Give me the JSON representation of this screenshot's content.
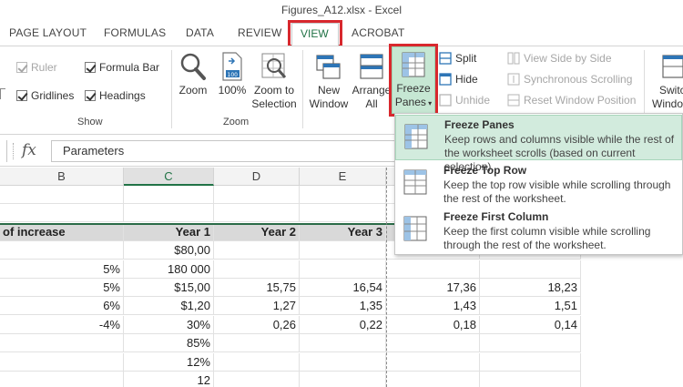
{
  "window": {
    "title": "Figures_A12.xlsx - Excel"
  },
  "tabs": [
    "PAGE LAYOUT",
    "FORMULAS",
    "DATA",
    "REVIEW",
    "VIEW",
    "ACROBAT"
  ],
  "ribbon": {
    "show_group": {
      "label": "Show",
      "ruler": "Ruler",
      "formula_bar": "Formula Bar",
      "gridlines": "Gridlines",
      "headings": "Headings"
    },
    "zoom_group": {
      "label": "Zoom",
      "zoom": "Zoom",
      "zoom100": "100%",
      "zoom_to_sel_1": "Zoom to",
      "zoom_to_sel_2": "Selection"
    },
    "window_group": {
      "new_window_1": "New",
      "new_window_2": "Window",
      "arrange_all_1": "Arrange",
      "arrange_all_2": "All",
      "freeze_1": "Freeze",
      "freeze_2": "Panes",
      "split": "Split",
      "hide": "Hide",
      "unhide": "Unhide",
      "view_side": "View Side by Side",
      "sync_scroll": "Synchronous Scrolling",
      "reset_pos": "Reset Window Position",
      "switch_1": "Switch",
      "switch_2": "Windows"
    }
  },
  "formula_bar": {
    "fx": "fx",
    "value": "Parameters"
  },
  "columns": [
    "B",
    "C",
    "D",
    "E"
  ],
  "rows": [
    [
      "",
      "",
      "",
      ""
    ],
    [
      "",
      "",
      "",
      ""
    ],
    [
      "of increase",
      "Year 1",
      "Year 2",
      "Year 3"
    ],
    [
      "",
      "$80,00",
      "",
      ""
    ],
    [
      "5%",
      "180 000",
      "",
      ""
    ],
    [
      "5%",
      "$15,00",
      "15,75",
      "16,54"
    ],
    [
      "6%",
      "$1,20",
      "1,27",
      "1,35"
    ],
    [
      "-4%",
      "30%",
      "0,26",
      "0,22"
    ],
    [
      "",
      "85%",
      "",
      ""
    ],
    [
      "",
      "12%",
      "",
      ""
    ],
    [
      "",
      "12",
      "",
      ""
    ]
  ],
  "extra_cols": [
    [
      "",
      ""
    ],
    [
      "",
      ""
    ],
    [
      "",
      ""
    ],
    [
      "",
      ""
    ],
    [
      "",
      ""
    ],
    [
      "17,36",
      "18,23"
    ],
    [
      "1,43",
      "1,51"
    ],
    [
      "0,18",
      "0,14"
    ],
    [
      "",
      ""
    ],
    [
      "",
      ""
    ],
    [
      "",
      ""
    ]
  ],
  "freeze_menu": [
    {
      "title": "Freeze Panes",
      "desc": "Keep rows and columns visible while the rest of the worksheet scrolls (based on current selection)."
    },
    {
      "title": "Freeze Top Row",
      "desc": "Keep the top row visible while scrolling through the rest of the worksheet."
    },
    {
      "title": "Freeze First Column",
      "desc": "Keep the first column visible while scrolling through the rest of the worksheet."
    }
  ],
  "colors": {
    "accent": "#217346",
    "highlight_box": "#d8282e",
    "freeze_bg": "#c6e7d3"
  }
}
